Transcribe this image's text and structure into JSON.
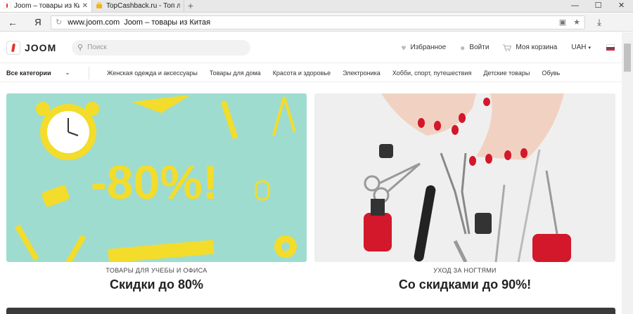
{
  "browser": {
    "tabs": [
      {
        "title": "Joom – товары из Китая",
        "active": true
      },
      {
        "title": "TopCashback.ru - Топ лучши",
        "active": false
      }
    ],
    "new_tab": "+",
    "window_controls": [
      "—",
      "☐",
      "✕"
    ],
    "back": "←",
    "yandex": "Я",
    "address": {
      "domain": "www.joom.com",
      "page_title": "Joom – товары из Китая"
    },
    "download": "⤓"
  },
  "header": {
    "logo_text": "JOOM",
    "search_placeholder": "Поиск",
    "favorites": "Избранное",
    "login": "Войти",
    "cart": "Моя корзина",
    "currency": "UAH",
    "currency_caret": "▾"
  },
  "categories": {
    "all_label": "Все категории",
    "items": [
      "Женская одежда и аксессуары",
      "Товары для дома",
      "Красота и здоровье",
      "Электроника",
      "Хобби, спорт, путешествия",
      "Детские товары",
      "Обувь"
    ]
  },
  "banners": [
    {
      "subtitle": "ТОВАРЫ ДЛЯ УЧЕБЫ И ОФИСА",
      "title": "Скидки до 80%",
      "image_text": "-80%!"
    },
    {
      "subtitle": "УХОД ЗА НОГТЯМИ",
      "title": "Со скидками до 90%!"
    }
  ],
  "colors": {
    "accent": "#e2342a",
    "banner_left_bg": "#9fdcd0",
    "yellow": "#f3dc2a",
    "nail_red": "#d2182a"
  }
}
